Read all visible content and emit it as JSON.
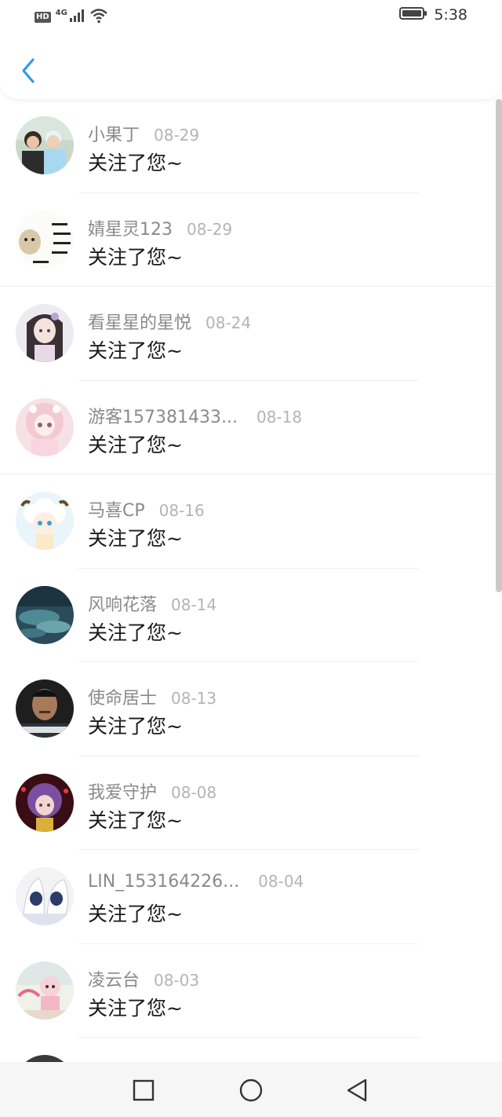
{
  "status_bar": {
    "hd": "HD",
    "network": "4G",
    "time": "5:38"
  },
  "nav": {
    "back_icon": "chevron-left-icon"
  },
  "colors": {
    "accent": "#2f9bea",
    "username": "#8a8a8a",
    "date": "#b4b4b4",
    "message": "#1a1a1a"
  },
  "notifications": [
    {
      "username": "小果丁",
      "date": "08-29",
      "message": "关注了您~",
      "avatar": "photo-two-people"
    },
    {
      "username": "婧星灵123",
      "date": "08-29",
      "message": "关注了您~",
      "avatar": "otter-meme"
    },
    {
      "username": "看星星的星悦",
      "date": "08-24",
      "message": "关注了您~",
      "avatar": "anime-girl-dark-hair"
    },
    {
      "username": "游客157381433...",
      "date": "08-18",
      "message": "关注了您~",
      "avatar": "anime-girl-pink"
    },
    {
      "username": "马喜CP",
      "date": "08-16",
      "message": "关注了您~",
      "avatar": "cartoon-sheep"
    },
    {
      "username": "风响花落",
      "date": "08-14",
      "message": "关注了您~",
      "avatar": "water-landscape"
    },
    {
      "username": "使命居士",
      "date": "08-13",
      "message": "关注了您~",
      "avatar": "man-portrait"
    },
    {
      "username": "我爱守护",
      "date": "08-08",
      "message": "关注了您~",
      "avatar": "anime-purple-hair"
    },
    {
      "username": "LIN_153164226...",
      "date": "08-04",
      "message": "关注了您~",
      "avatar": "white-fox-anime"
    },
    {
      "username": "凌云台",
      "date": "08-03",
      "message": "关注了您~",
      "avatar": "pink-doll"
    }
  ],
  "bottom_nav": {
    "recent": "square-icon",
    "home": "circle-icon",
    "back": "triangle-back-icon"
  }
}
